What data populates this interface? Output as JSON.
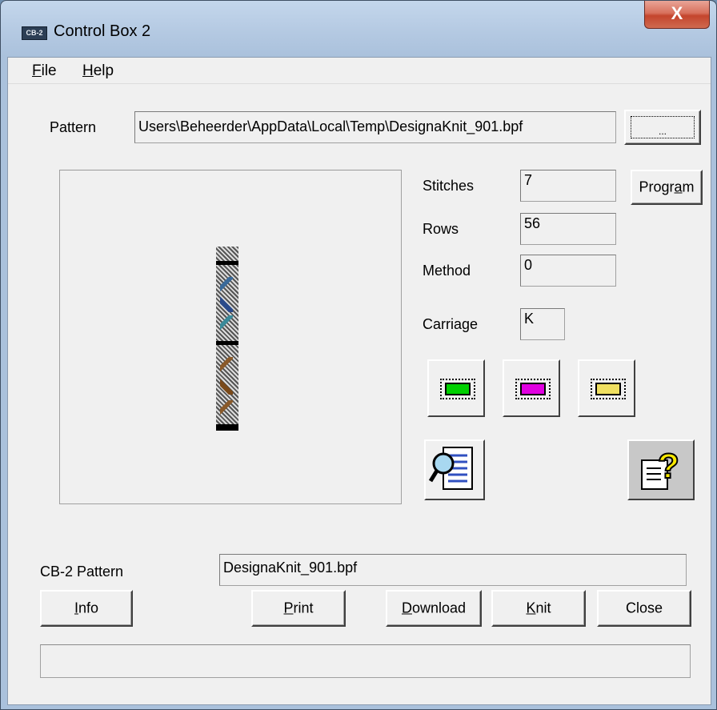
{
  "window": {
    "title": "Control Box 2",
    "icon_text": "CB-2",
    "close_glyph": "X"
  },
  "menu": {
    "file": {
      "mnemonic": "F",
      "rest": "ile"
    },
    "help": {
      "mnemonic": "H",
      "rest": "elp"
    }
  },
  "pattern": {
    "label": "Pattern",
    "path": "Users\\Beheerder\\AppData\\Local\\Temp\\DesignaKnit_901.bpf",
    "browse_label": "..."
  },
  "fields": {
    "stitches": {
      "label": "Stitches",
      "value": "7"
    },
    "rows": {
      "label": "Rows",
      "value": "56"
    },
    "method": {
      "label": "Method",
      "value": "0"
    },
    "carriage": {
      "label": "Carriage",
      "value": "K"
    }
  },
  "program_button": {
    "pre": "Progr",
    "mnemonic": "a",
    "post": "m"
  },
  "carriage_icons": [
    {
      "name": "knit-carriage-green-icon",
      "color": "#00d000"
    },
    {
      "name": "knit-carriage-magenta-icon",
      "color": "#e000e0"
    },
    {
      "name": "knit-carriage-yellow-icon",
      "color": "#f0e060"
    }
  ],
  "cb2_pattern": {
    "label": "CB-2 Pattern",
    "value": "DesignaKnit_901.bpf"
  },
  "buttons": {
    "info": {
      "mnemonic": "I",
      "rest": "nfo"
    },
    "print": {
      "mnemonic": "P",
      "rest": "rint"
    },
    "download": {
      "mnemonic": "D",
      "rest": "ownload"
    },
    "knit": {
      "mnemonic": "K",
      "rest": "nit"
    },
    "close": {
      "label": "Close"
    }
  },
  "status": {
    "text": ""
  }
}
